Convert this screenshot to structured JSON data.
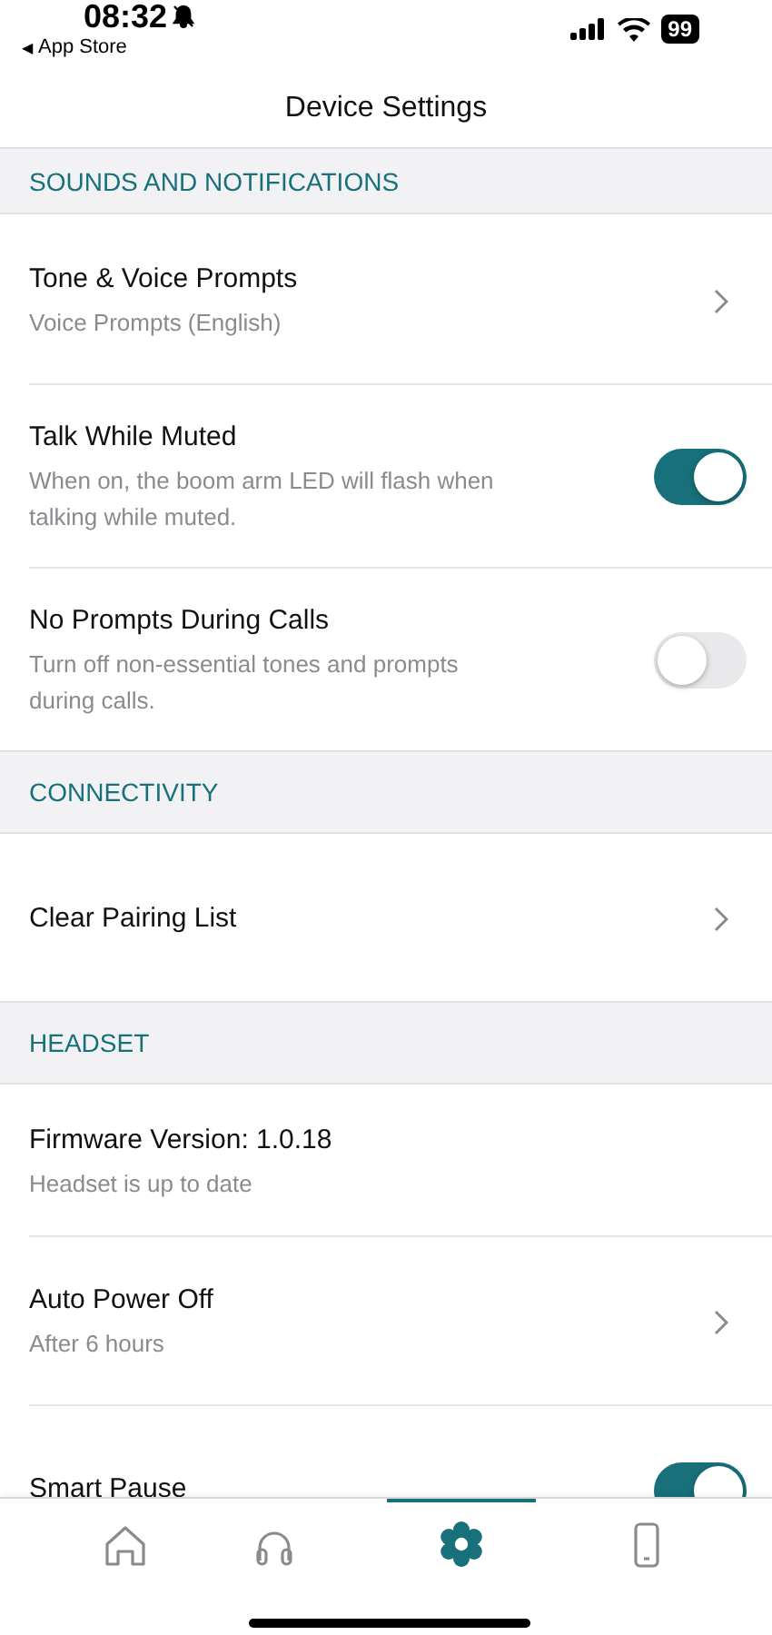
{
  "status_bar": {
    "time": "08:32",
    "back_arrow": "◀",
    "back_label": "App Store",
    "battery": "99"
  },
  "nav": {
    "title": "Device Settings"
  },
  "sections": [
    {
      "title": "SOUNDS AND NOTIFICATIONS",
      "rows": [
        {
          "kind": "link",
          "title": "Tone & Voice Prompts",
          "subtitle": "Voice Prompts (English)"
        },
        {
          "kind": "toggle",
          "title": "Talk While Muted",
          "subtitle": "When on, the boom arm LED will flash when talking while muted.",
          "on": true
        },
        {
          "kind": "toggle",
          "title": "No Prompts During Calls",
          "subtitle": "Turn off non-essential tones and prompts during calls.",
          "on": false
        }
      ]
    },
    {
      "title": "CONNECTIVITY",
      "rows": [
        {
          "kind": "link",
          "title": "Clear Pairing List"
        }
      ]
    },
    {
      "title": "HEADSET",
      "rows": [
        {
          "kind": "info",
          "title": "Firmware Version: 1.0.18",
          "subtitle": "Headset is up to date"
        },
        {
          "kind": "link",
          "title": "Auto Power Off",
          "subtitle": "After 6 hours"
        },
        {
          "kind": "toggle",
          "title": "Smart Pause",
          "on": true
        }
      ]
    }
  ],
  "tab_bar": {
    "tabs": [
      {
        "kind": "home",
        "selected": false
      },
      {
        "kind": "headphones",
        "selected": false
      },
      {
        "kind": "settings",
        "selected": true
      },
      {
        "kind": "phone",
        "selected": false
      }
    ]
  }
}
